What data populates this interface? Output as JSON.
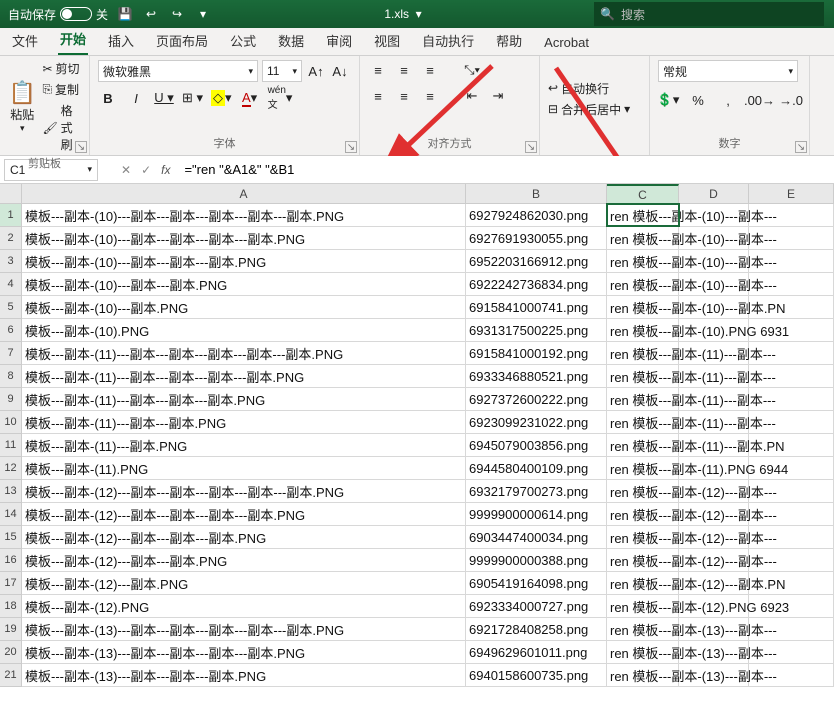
{
  "titlebar": {
    "autosave_label": "自动保存",
    "autosave_state": "关",
    "filename": "1.xls",
    "search_placeholder": "搜索"
  },
  "tabs": [
    "文件",
    "开始",
    "插入",
    "页面布局",
    "公式",
    "数据",
    "审阅",
    "视图",
    "自动执行",
    "帮助",
    "Acrobat"
  ],
  "active_tab": "开始",
  "ribbon": {
    "clipboard": {
      "label": "剪贴板",
      "paste": "粘贴",
      "cut": "剪切",
      "copy": "复制",
      "format_painter": "格式刷"
    },
    "font": {
      "label": "字体",
      "name": "微软雅黑",
      "size": "11"
    },
    "align": {
      "label": "对齐方式",
      "wrap": "自动换行",
      "merge": "合并后居中"
    },
    "number": {
      "label": "数字",
      "format": "常规"
    }
  },
  "namebox_value": "C1",
  "formula": "=\"ren \"&A1&\" \"&B1",
  "columns": [
    "A",
    "B",
    "C",
    "D",
    "E"
  ],
  "rows": [
    {
      "A": "模板---副本-(10)---副本---副本---副本---副本---副本.PNG",
      "B": "6927924862030.png",
      "C": "ren 模板---副本-(10)---副本---"
    },
    {
      "A": "模板---副本-(10)---副本---副本---副本---副本.PNG",
      "B": "6927691930055.png",
      "C": "ren 模板---副本-(10)---副本---"
    },
    {
      "A": "模板---副本-(10)---副本---副本---副本.PNG",
      "B": "6952203166912.png",
      "C": "ren 模板---副本-(10)---副本---"
    },
    {
      "A": "模板---副本-(10)---副本---副本.PNG",
      "B": "6922242736834.png",
      "C": "ren 模板---副本-(10)---副本---"
    },
    {
      "A": "模板---副本-(10)---副本.PNG",
      "B": "6915841000741.png",
      "C": "ren 模板---副本-(10)---副本.PN"
    },
    {
      "A": "模板---副本-(10).PNG",
      "B": "6931317500225.png",
      "C": "ren 模板---副本-(10).PNG 6931"
    },
    {
      "A": "模板---副本-(11)---副本---副本---副本---副本---副本.PNG",
      "B": "6915841000192.png",
      "C": "ren 模板---副本-(11)---副本---"
    },
    {
      "A": "模板---副本-(11)---副本---副本---副本---副本.PNG",
      "B": "6933346880521.png",
      "C": "ren 模板---副本-(11)---副本---"
    },
    {
      "A": "模板---副本-(11)---副本---副本---副本.PNG",
      "B": "6927372600222.png",
      "C": "ren 模板---副本-(11)---副本---"
    },
    {
      "A": "模板---副本-(11)---副本---副本.PNG",
      "B": "6923099231022.png",
      "C": "ren 模板---副本-(11)---副本---"
    },
    {
      "A": "模板---副本-(11)---副本.PNG",
      "B": "6945079003856.png",
      "C": "ren 模板---副本-(11)---副本.PN"
    },
    {
      "A": "模板---副本-(11).PNG",
      "B": "6944580400109.png",
      "C": "ren 模板---副本-(11).PNG 6944"
    },
    {
      "A": "模板---副本-(12)---副本---副本---副本---副本---副本.PNG",
      "B": "6932179700273.png",
      "C": "ren 模板---副本-(12)---副本---"
    },
    {
      "A": "模板---副本-(12)---副本---副本---副本---副本.PNG",
      "B": "9999900000614.png",
      "C": "ren 模板---副本-(12)---副本---"
    },
    {
      "A": "模板---副本-(12)---副本---副本---副本.PNG",
      "B": "6903447400034.png",
      "C": "ren 模板---副本-(12)---副本---"
    },
    {
      "A": "模板---副本-(12)---副本---副本.PNG",
      "B": "9999900000388.png",
      "C": "ren 模板---副本-(12)---副本---"
    },
    {
      "A": "模板---副本-(12)---副本.PNG",
      "B": "6905419164098.png",
      "C": "ren 模板---副本-(12)---副本.PN"
    },
    {
      "A": "模板---副本-(12).PNG",
      "B": "6923334000727.png",
      "C": "ren 模板---副本-(12).PNG 6923"
    },
    {
      "A": "模板---副本-(13)---副本---副本---副本---副本---副本.PNG",
      "B": "6921728408258.png",
      "C": "ren 模板---副本-(13)---副本---"
    },
    {
      "A": "模板---副本-(13)---副本---副本---副本---副本.PNG",
      "B": "6949629601011.png",
      "C": "ren 模板---副本-(13)---副本---"
    },
    {
      "A": "模板---副本-(13)---副本---副本---副本.PNG",
      "B": "6940158600735.png",
      "C": "ren 模板---副本-(13)---副本---"
    }
  ]
}
